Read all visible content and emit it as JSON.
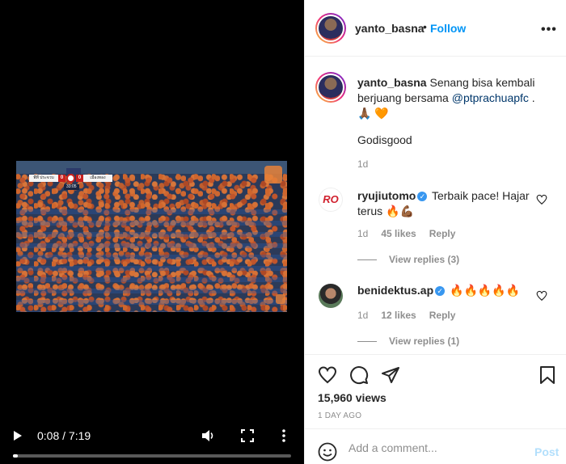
{
  "video": {
    "scoreboard": {
      "home_team": "พีที ประจวบ",
      "home_score": "0",
      "away_score": "0",
      "away_team": "เมืองทอง",
      "match_clock": "33:05"
    },
    "time_display": "0:08 / 7:19",
    "progress": 0.0186,
    "icons": {
      "play": "play-icon",
      "volume": "volume-icon",
      "fullscreen": "fullscreen-icon",
      "more": "more-vertical-icon"
    }
  },
  "header": {
    "username": "yanto_basna",
    "separator": "•",
    "follow_label": "Follow",
    "more_label": "•••"
  },
  "caption": {
    "username": "yanto_basna",
    "text": " Senang bisa kembali berjuang bersama ",
    "mention": "@ptprachuapfc",
    "suffix": " . 🙏🏾 🧡",
    "line2": "Godisgood",
    "age": "1d"
  },
  "comments": [
    {
      "username": "ryujiutomo",
      "verified": true,
      "avatar_text": "RO",
      "text": " Terbaik pace! Hajar terus 🔥💪🏾",
      "age": "1d",
      "likes": "45 likes",
      "reply_label": "Reply",
      "view_replies": "View replies (3)"
    },
    {
      "username": "benidektus.ap",
      "verified": true,
      "text": " 🔥🔥🔥🔥🔥",
      "age": "1d",
      "likes": "12 likes",
      "reply_label": "Reply",
      "view_replies": "View replies (1)"
    }
  ],
  "actions": {
    "views": "15,960 views",
    "date": "1 DAY AGO"
  },
  "add_comment": {
    "placeholder": "Add a comment...",
    "post_label": "Post"
  },
  "colors": {
    "link_blue": "#0095f6",
    "post_disabled": "#b2dffc",
    "verified": "#3897f0",
    "muted": "#8e8e8e"
  }
}
